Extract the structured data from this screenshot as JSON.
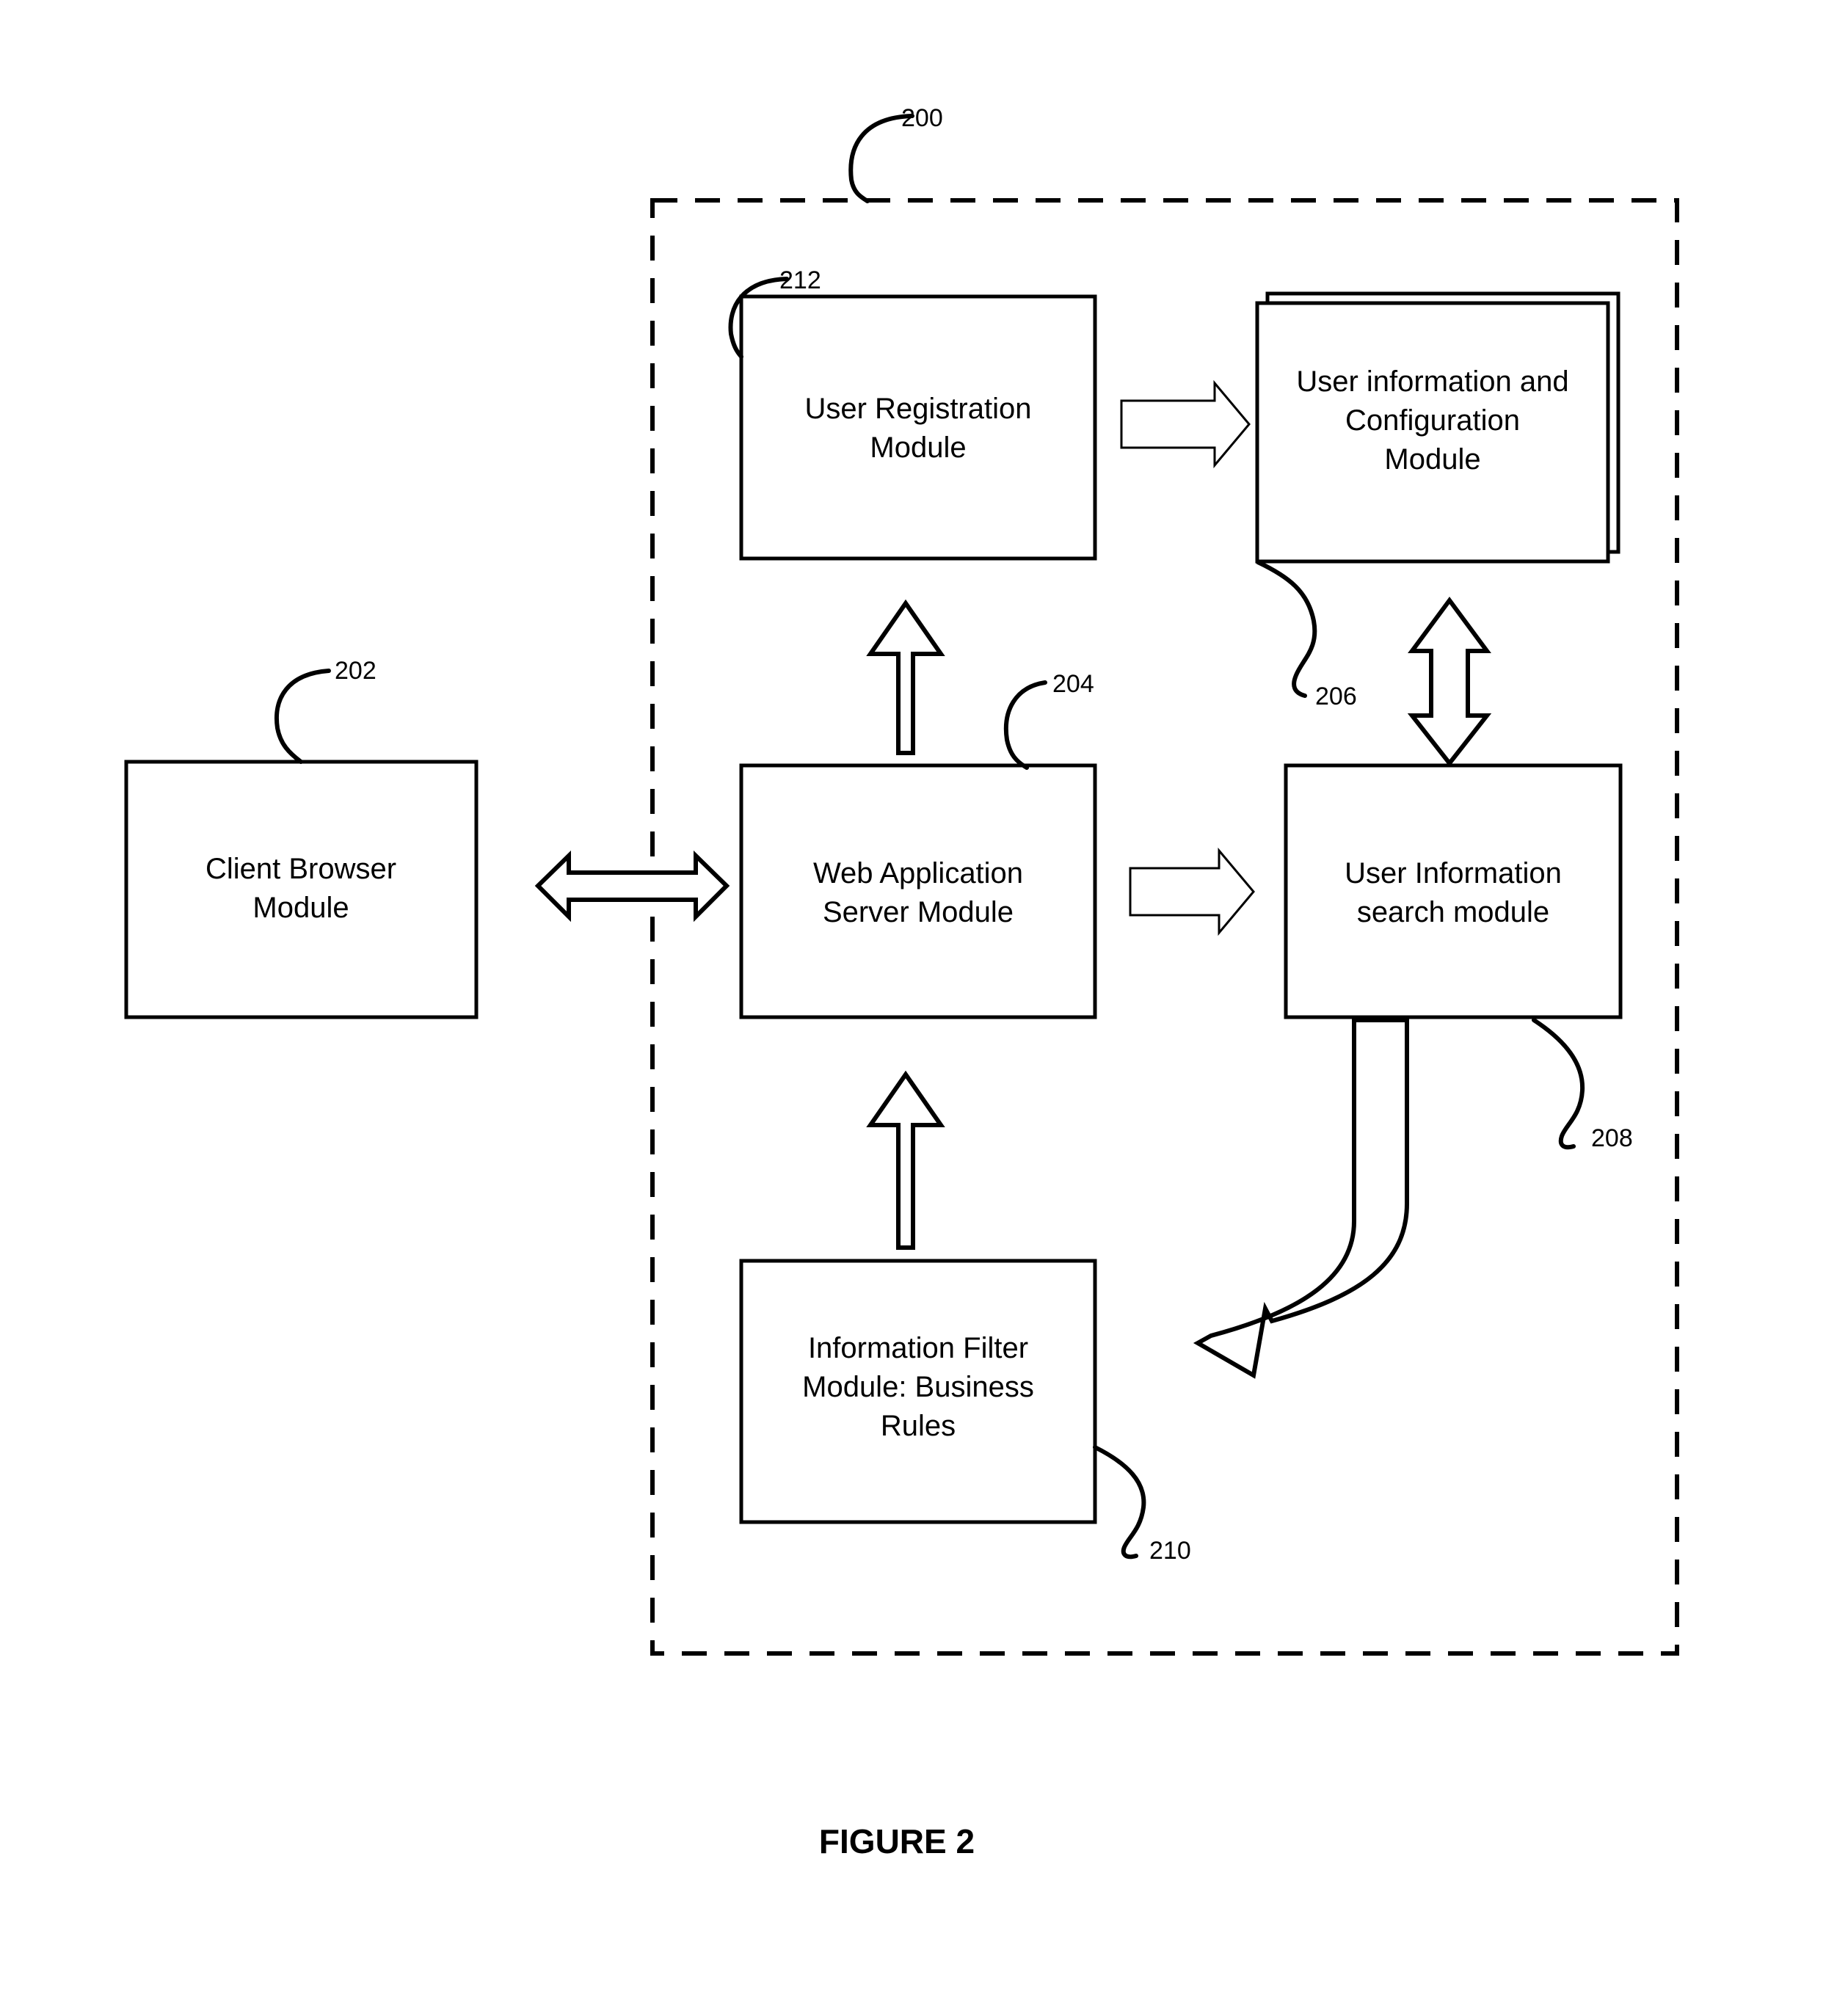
{
  "figure": {
    "caption": "FIGURE 2",
    "system_ref": "200"
  },
  "boundary": {
    "name": "system-boundary",
    "style": "dashed",
    "ref": "200"
  },
  "nodes": [
    {
      "id": "client-browser-module",
      "label": "Client Browser\nModule",
      "line1": "Client Browser",
      "line2": "Module",
      "ref": "202",
      "inside_boundary": false,
      "border": "single"
    },
    {
      "id": "user-registration-module",
      "label": "User Registration\nModule",
      "line1": "User Registration",
      "line2": "Module",
      "ref": "212",
      "inside_boundary": true,
      "border": "single"
    },
    {
      "id": "user-information-and-configuration-module",
      "label": "User information and\nConfiguration\nModule",
      "line1": "User information and",
      "line2": "Configuration",
      "line3": "Module",
      "ref": "206",
      "inside_boundary": true,
      "border": "double"
    },
    {
      "id": "web-application-server-module",
      "label": "Web Application\nServer Module",
      "line1": "Web Application",
      "line2": "Server Module",
      "ref": "204",
      "inside_boundary": true,
      "border": "single"
    },
    {
      "id": "user-information-search-module",
      "label": "User Information\nsearch module",
      "line1": "User Information",
      "line2": "search module",
      "ref": "208",
      "inside_boundary": true,
      "border": "single"
    },
    {
      "id": "information-filter-module",
      "label": "Information Filter\nModule: Business\nRules",
      "line1": "Information Filter",
      "line2": "Module: Business",
      "line3": "Rules",
      "ref": "210",
      "inside_boundary": true,
      "border": "single"
    }
  ],
  "connectors": [
    {
      "id": "client-browser-to-web-server",
      "from": "client-browser-module",
      "to": "web-application-server-module",
      "direction": "bidirectional",
      "orientation": "horizontal",
      "style": "hollow-block-arrow-bold"
    },
    {
      "id": "user-registration-to-configuration",
      "from": "user-registration-module",
      "to": "user-information-and-configuration-module",
      "direction": "right",
      "orientation": "horizontal",
      "style": "hollow-block-arrow-thin"
    },
    {
      "id": "web-server-to-user-registration",
      "from": "web-application-server-module",
      "to": "user-registration-module",
      "direction": "up",
      "orientation": "vertical",
      "style": "hollow-block-arrow-bold"
    },
    {
      "id": "configuration-to-search-module",
      "from": "user-information-and-configuration-module",
      "to": "user-information-search-module",
      "direction": "bidirectional",
      "orientation": "vertical",
      "style": "hollow-block-arrow-bold"
    },
    {
      "id": "web-server-to-search-module",
      "from": "web-application-server-module",
      "to": "user-information-search-module",
      "direction": "right",
      "orientation": "horizontal",
      "style": "hollow-block-arrow-thin"
    },
    {
      "id": "filter-to-web-server",
      "from": "information-filter-module",
      "to": "web-application-server-module",
      "direction": "up",
      "orientation": "vertical",
      "style": "hollow-block-arrow-bold"
    },
    {
      "id": "search-module-to-filter",
      "from": "user-information-search-module",
      "to": "information-filter-module",
      "direction": "curved-down-left",
      "orientation": "curved",
      "style": "hollow-curved-block-arrow"
    }
  ],
  "reference_numerals": [
    "200",
    "202",
    "204",
    "206",
    "208",
    "210",
    "212"
  ],
  "colors": {
    "stroke": "#000000",
    "fill": "#ffffff",
    "background": "#ffffff"
  }
}
